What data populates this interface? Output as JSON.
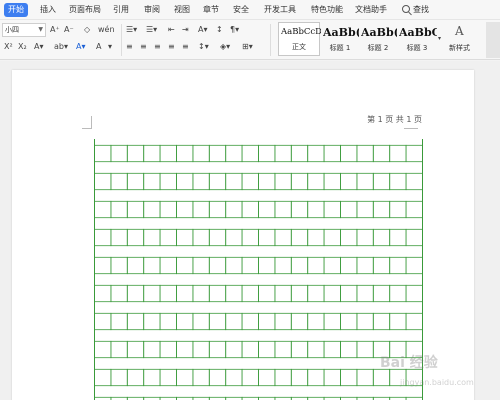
{
  "menu": {
    "items": [
      {
        "label": "开始",
        "active": true
      },
      {
        "label": "插入"
      },
      {
        "label": "页面布局"
      },
      {
        "label": "引用"
      },
      {
        "label": "审阅"
      },
      {
        "label": "视图"
      },
      {
        "label": "章节"
      },
      {
        "label": "安全"
      },
      {
        "label": "开发工具"
      },
      {
        "label": "特色功能"
      },
      {
        "label": "文档助手"
      }
    ],
    "search_label": "查找"
  },
  "ribbon": {
    "font_size_value": "小四",
    "styles": [
      {
        "sample": "AaBbCcDd",
        "name": "正文",
        "selected": true
      },
      {
        "sample": "AaBb(",
        "name": "标题 1"
      },
      {
        "sample": "AaBb(",
        "name": "标题 2"
      },
      {
        "sample": "AaBbC",
        "name": "标题 3"
      }
    ],
    "new_style_label": "新样式"
  },
  "document": {
    "header": "第 1 页 共 1 页",
    "grid_color": "#3a9a3a",
    "grid_columns": 20,
    "grid_rows": 10
  },
  "watermark": {
    "text": "Bai 经验",
    "url": "jingyan.baidu.com"
  }
}
